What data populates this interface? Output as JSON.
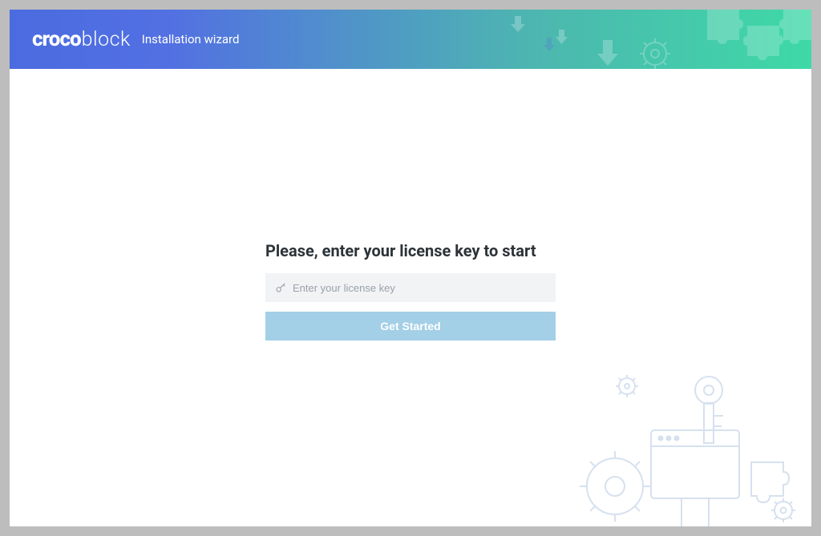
{
  "header": {
    "logo_a": "croco",
    "logo_b": "block",
    "subtitle": "Installation wizard"
  },
  "main": {
    "headline": "Please, enter your license key to start",
    "input_placeholder": "Enter your license key",
    "cta_label": "Get Started"
  }
}
